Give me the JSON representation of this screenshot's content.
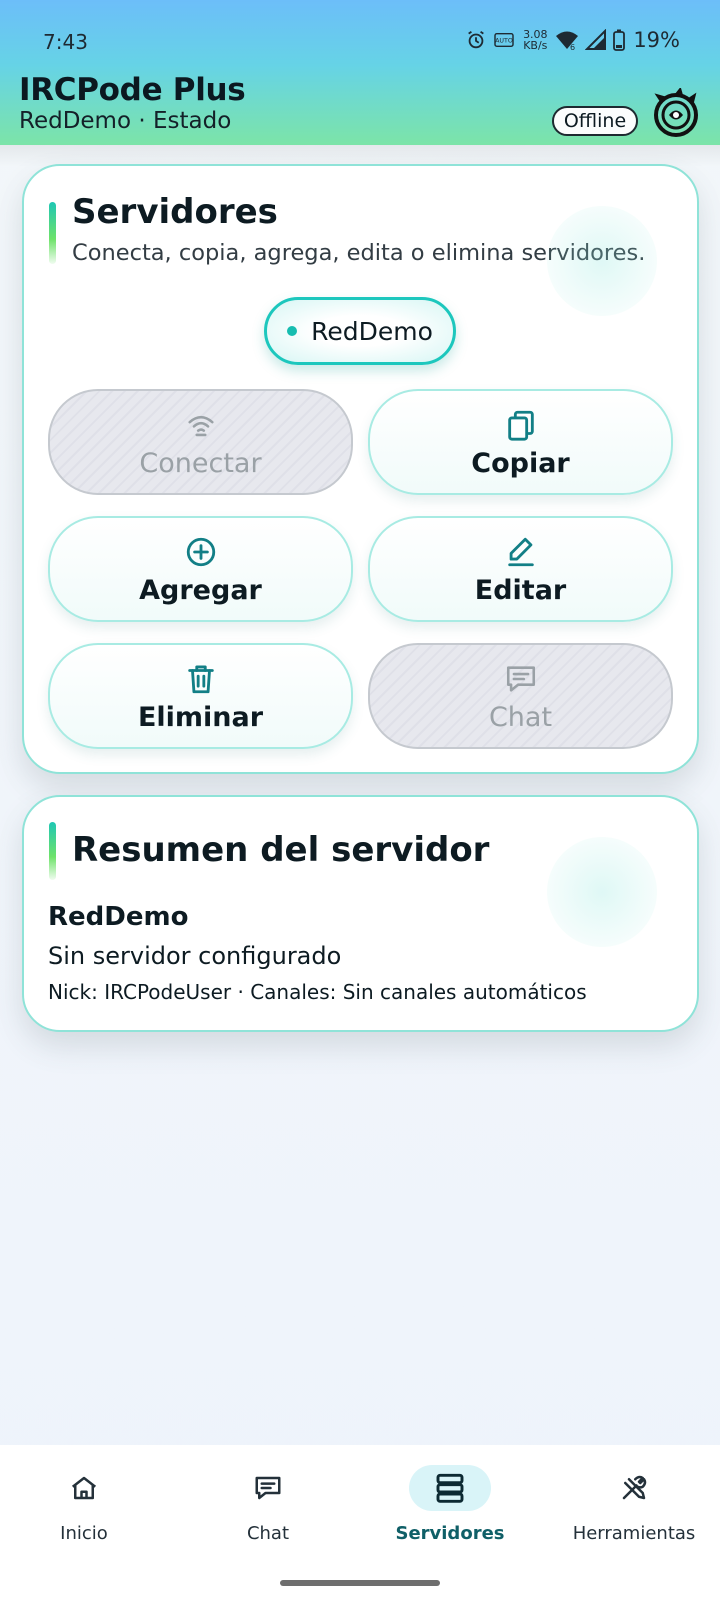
{
  "status_bar": {
    "time": "7:43",
    "net_speed_value": "3.08",
    "net_speed_unit": "KB/s",
    "battery": "19%",
    "icons": [
      "alarm-icon",
      "auto-data-icon",
      "wifi-icon",
      "signal-icon",
      "battery-icon"
    ]
  },
  "header": {
    "title": "IRCPode Plus",
    "subtitle": "RedDemo · Estado",
    "connection_status": "Offline",
    "logo": "dragon-logo"
  },
  "servers_card": {
    "title": "Servidores",
    "subtitle": "Conecta, copia, agrega, edita o elimina servidores.",
    "selected_server": "RedDemo",
    "actions": [
      {
        "id": "connect",
        "label": "Conectar",
        "icon": "connect-icon",
        "enabled": false
      },
      {
        "id": "copy",
        "label": "Copiar",
        "icon": "copy-icon",
        "enabled": true
      },
      {
        "id": "add",
        "label": "Agregar",
        "icon": "add-circle-icon",
        "enabled": true
      },
      {
        "id": "edit",
        "label": "Editar",
        "icon": "edit-icon",
        "enabled": true
      },
      {
        "id": "delete",
        "label": "Eliminar",
        "icon": "trash-icon",
        "enabled": true
      },
      {
        "id": "chat",
        "label": "Chat",
        "icon": "chat-icon",
        "enabled": false
      }
    ]
  },
  "summary_card": {
    "title": "Resumen del servidor",
    "server_name": "RedDemo",
    "server_status": "Sin servidor configurado",
    "details": "Nick: IRCPodeUser · Canales: Sin canales automáticos"
  },
  "bottom_nav": {
    "items": [
      {
        "label": "Inicio",
        "icon": "home-icon",
        "active": false
      },
      {
        "label": "Chat",
        "icon": "chat-icon",
        "active": false
      },
      {
        "label": "Servidores",
        "icon": "servers-icon",
        "active": true
      },
      {
        "label": "Herramientas",
        "icon": "tools-icon",
        "active": false
      }
    ]
  },
  "colors": {
    "accent": "#1cc7bd",
    "active_nav_text": "#0f5f67",
    "active_nav_bg": "#d9f4f8",
    "disabled_text": "#9aa1a6"
  }
}
